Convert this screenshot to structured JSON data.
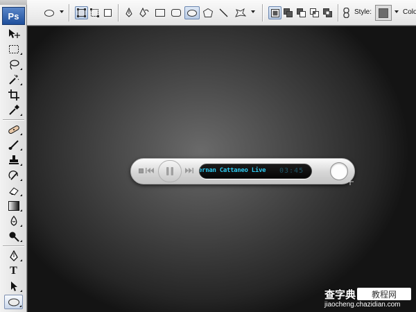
{
  "app": {
    "logo": "Ps",
    "brand_color": "#1e4f9c"
  },
  "options_bar": {
    "style_label": "Style:",
    "color_label_truncated": "Colo",
    "style_swatch_color": "#6b6b6b",
    "buttons": [
      "ellipse-preset-icon",
      "shape-layers-icon",
      "paths-icon",
      "fill-pixels-icon",
      "pen-tool-icon",
      "freeform-pen-icon",
      "rectangle-icon",
      "rounded-rectangle-icon",
      "ellipse-icon",
      "polygon-icon",
      "line-icon",
      "custom-shape-icon",
      "new-shape-area-icon",
      "add-to-shape-icon",
      "subtract-shape-icon",
      "intersect-shape-icon",
      "exclude-shape-icon",
      "link-icon"
    ],
    "selected": "ellipse-icon"
  },
  "toolbox": {
    "tools": [
      "move-tool-icon",
      "marquee-tool-icon",
      "lasso-tool-icon",
      "magic-wand-icon",
      "crop-tool-icon",
      "eyedropper-icon",
      "healing-brush-icon",
      "brush-tool-icon",
      "clone-stamp-icon",
      "history-brush-icon",
      "eraser-tool-icon",
      "gradient-tool-icon",
      "blur-tool-icon",
      "dodge-tool-icon",
      "pen-tool-icon",
      "type-tool-icon",
      "path-selection-icon",
      "ellipse-tool-icon"
    ],
    "type_tool_glyph": "T",
    "selected": "ellipse-tool-icon"
  },
  "canvas": {
    "player": {
      "track_text": "ernan Cattaneo Live",
      "time_text": "03:45",
      "display_text_color": "#2ecbf2"
    }
  },
  "watermark": {
    "title": "查字典",
    "badge": "教程网",
    "url": "jiaocheng.chazidian.com"
  }
}
